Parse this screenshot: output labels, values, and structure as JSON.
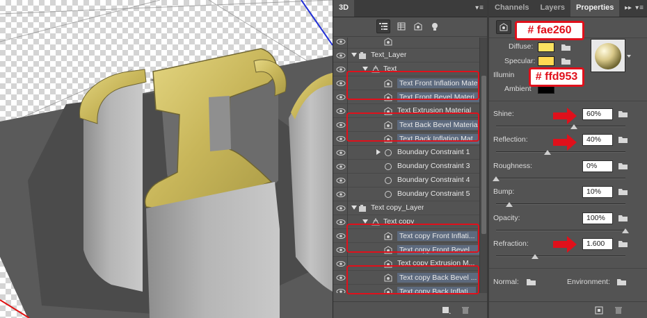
{
  "panels": {
    "left": {
      "tabs": [
        {
          "label": "3D",
          "active": true
        }
      ],
      "menu_glyph": "▾≡",
      "toolbar_icons": [
        "scene-filter-icon",
        "mesh-filter-icon",
        "material-filter-icon",
        "light-filter-icon"
      ]
    },
    "right": {
      "tabs": [
        {
          "label": "Channels",
          "active": false
        },
        {
          "label": "Layers",
          "active": false
        },
        {
          "label": "Properties",
          "active": true
        }
      ],
      "collapse_glyph": "▸▸",
      "menu_glyph": "▾≡"
    }
  },
  "layers": [
    {
      "label": "",
      "type": "material",
      "indent": 3,
      "selected": false,
      "eye": true
    },
    {
      "label": "Text_Layer",
      "type": "layer",
      "indent": 1,
      "selected": false,
      "eye": true,
      "expanded": true
    },
    {
      "label": "Text",
      "type": "mesh",
      "indent": 2,
      "selected": false,
      "eye": true,
      "expanded": true
    },
    {
      "label": "Text Front Inflation Mate...",
      "type": "material",
      "indent": 3,
      "selected": true,
      "eye": true
    },
    {
      "label": "Text Front Bevel Materi...",
      "type": "material",
      "indent": 3,
      "selected": true,
      "eye": true
    },
    {
      "label": "Text Extrusion Material",
      "type": "material",
      "indent": 3,
      "selected": false,
      "eye": true
    },
    {
      "label": "Text Back Bevel Material",
      "type": "material",
      "indent": 3,
      "selected": true,
      "eye": true
    },
    {
      "label": "Text Back Inflation Mat...",
      "type": "material",
      "indent": 3,
      "selected": true,
      "eye": true
    },
    {
      "label": "Boundary Constraint 1",
      "type": "constraint",
      "indent": 3,
      "selected": false,
      "eye": true,
      "collapsed": true
    },
    {
      "label": "Boundary Constraint 3",
      "type": "constraint",
      "indent": 3,
      "selected": false,
      "eye": true
    },
    {
      "label": "Boundary Constraint 4",
      "type": "constraint",
      "indent": 3,
      "selected": false,
      "eye": true
    },
    {
      "label": "Boundary Constraint 5",
      "type": "constraint",
      "indent": 3,
      "selected": false,
      "eye": true
    },
    {
      "label": "Text copy_Layer",
      "type": "layer",
      "indent": 1,
      "selected": false,
      "eye": true,
      "expanded": true
    },
    {
      "label": "Text copy",
      "type": "mesh",
      "indent": 2,
      "selected": false,
      "eye": true,
      "expanded": true
    },
    {
      "label": "Text copy Front Inflati...",
      "type": "material",
      "indent": 3,
      "selected": true,
      "eye": true
    },
    {
      "label": "Text copy Front Bevel ...",
      "type": "material",
      "indent": 3,
      "selected": true,
      "eye": true
    },
    {
      "label": "Text copy Extrusion M...",
      "type": "material",
      "indent": 3,
      "selected": false,
      "eye": true
    },
    {
      "label": "Text copy Back Bevel ...",
      "type": "material",
      "indent": 3,
      "selected": true,
      "eye": true
    },
    {
      "label": "Text copy Back Inflati...",
      "type": "material",
      "indent": 3,
      "selected": true,
      "eye": true
    }
  ],
  "properties": {
    "diffuse_label": "Diffuse:",
    "specular_label": "Specular:",
    "illumination_label": "Illumin",
    "ambient_label": "Ambient",
    "diffuse_color": "#fae260",
    "specular_color": "#ffd953",
    "callout_diffuse": "# fae260",
    "callout_specular": "# ffd953",
    "sliders": [
      {
        "label": "Shine:",
        "value": "60%",
        "fraction": 0.6
      },
      {
        "label": "Reflection:",
        "value": "40%",
        "fraction": 0.4
      },
      {
        "label": "Roughness:",
        "value": "0%",
        "fraction": 0.0
      },
      {
        "label": "Bump:",
        "value": "10%",
        "fraction": 0.1
      },
      {
        "label": "Opacity:",
        "value": "100%",
        "fraction": 1.0
      },
      {
        "label": "Refraction:",
        "value": "1.600",
        "fraction": 0.3
      }
    ],
    "normal_label": "Normal:",
    "environment_label": "Environment:"
  },
  "colors": {
    "highlight": "#e0101b",
    "selected_row": "#5d6a7e",
    "gold": "#c8b65a",
    "grey_extrusion": "#a3a3a3"
  }
}
